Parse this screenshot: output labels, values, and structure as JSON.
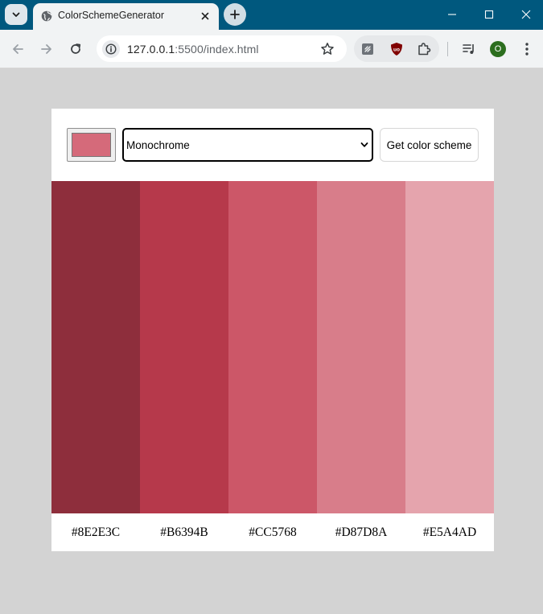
{
  "browser": {
    "tab_title": "ColorSchemeGenerator",
    "url_host": "127.0.0.1",
    "url_rest": ":5500/index.html",
    "profile_initial": "O",
    "accent_color": "#00587e"
  },
  "app": {
    "seed_color": "#D56A7A",
    "scheme_mode": "Monochrome",
    "get_scheme_label": "Get color scheme",
    "colors": [
      {
        "hex": "#8E2E3C",
        "label": "#8E2E3C"
      },
      {
        "hex": "#B6394B",
        "label": "#B6394B"
      },
      {
        "hex": "#CC5768",
        "label": "#CC5768"
      },
      {
        "hex": "#D87D8A",
        "label": "#D87D8A"
      },
      {
        "hex": "#E5A4AD",
        "label": "#E5A4AD"
      }
    ]
  },
  "icons": {
    "tab_menu": "chevron-down-icon",
    "favicon": "globe-icon",
    "tab_close": "close-icon",
    "new_tab": "plus-icon",
    "back": "back-arrow-icon",
    "forward": "forward-arrow-icon",
    "reload": "reload-icon",
    "site_info": "info-icon",
    "bookmark": "star-icon",
    "extensions": [
      "stylus-extension-icon",
      "ublock-origin-icon",
      "puzzle-extensions-icon"
    ],
    "media": "media-controls-icon",
    "menu": "kebab-menu-icon"
  }
}
